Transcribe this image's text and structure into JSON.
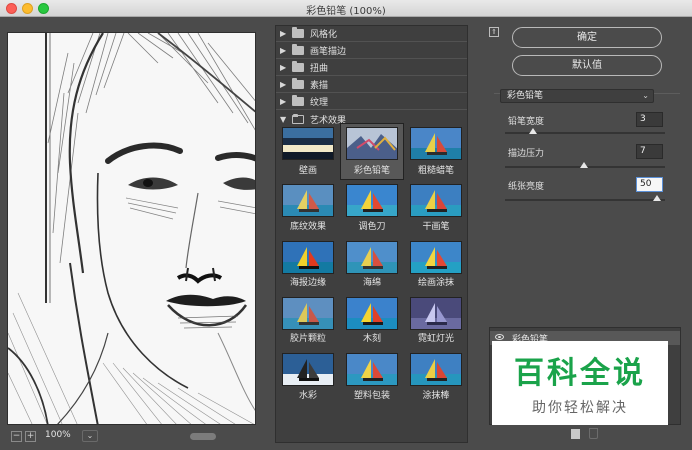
{
  "window": {
    "title": "彩色铅笔 (100%)"
  },
  "preview": {
    "zoom": "100%",
    "zoom_out": "−",
    "zoom_in": "+",
    "dropdown": "⌄"
  },
  "browser": {
    "categories": [
      {
        "label": "风格化",
        "arrow": "▶"
      },
      {
        "label": "画笔描边",
        "arrow": "▶"
      },
      {
        "label": "扭曲",
        "arrow": "▶"
      },
      {
        "label": "素描",
        "arrow": "▶"
      },
      {
        "label": "纹理",
        "arrow": "▶"
      },
      {
        "label": "艺术效果",
        "arrow": "▼"
      }
    ],
    "filters": [
      "壁画",
      "彩色铅笔",
      "粗糙蜡笔",
      "底纹效果",
      "调色刀",
      "干画笔",
      "海报边缘",
      "海绵",
      "绘画涂抹",
      "胶片颗粒",
      "木刻",
      "霓虹灯光",
      "水彩",
      "塑料包装",
      "涂抹棒"
    ],
    "selected_filter": "彩色铅笔"
  },
  "actions": {
    "ok": "确定",
    "default": "默认值",
    "collapse": "⇑"
  },
  "settings": {
    "filter": "彩色铅笔",
    "chevron": "⌄",
    "params": [
      {
        "label": "铅笔宽度",
        "value": "3",
        "level": 0.1
      },
      {
        "label": "描边压力",
        "value": "7",
        "level": 0.47
      },
      {
        "label": "纸张亮度",
        "value": "50",
        "level": 1.0
      }
    ]
  },
  "layers": {
    "items": [
      {
        "name": "彩色铅笔"
      }
    ]
  },
  "watermark": {
    "title": "百科全说",
    "subtitle": "助你轻松解决"
  }
}
